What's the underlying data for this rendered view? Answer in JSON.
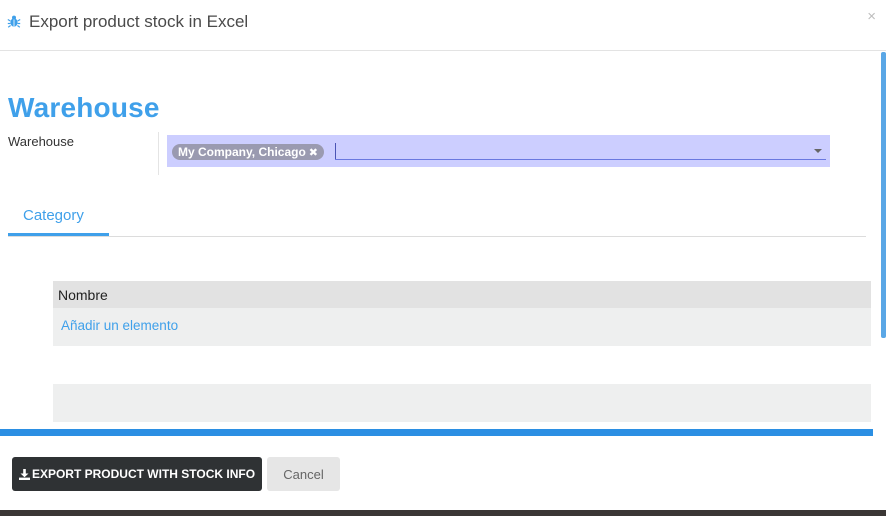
{
  "dialog": {
    "title": "Export product stock in Excel",
    "close_glyph": "×"
  },
  "form": {
    "section_title": "Warehouse",
    "warehouse_label": "Warehouse",
    "warehouse_tag": "My Company, Chicago",
    "tag_remove_glyph": "✖"
  },
  "tabs": [
    {
      "label": "Category",
      "active": true
    }
  ],
  "table": {
    "column_header": "Nombre",
    "add_item_link": "Añadir un elemento"
  },
  "footer": {
    "export_button": "EXPORT PRODUCT WITH STOCK INFO",
    "cancel_button": "Cancel"
  },
  "icons": {
    "header_icon": "bug-icon",
    "export_icon": "download-icon"
  },
  "colors": {
    "accent": "#3fa0ea",
    "select_bg": "#ccceff",
    "primary_button": "#2f3234"
  }
}
